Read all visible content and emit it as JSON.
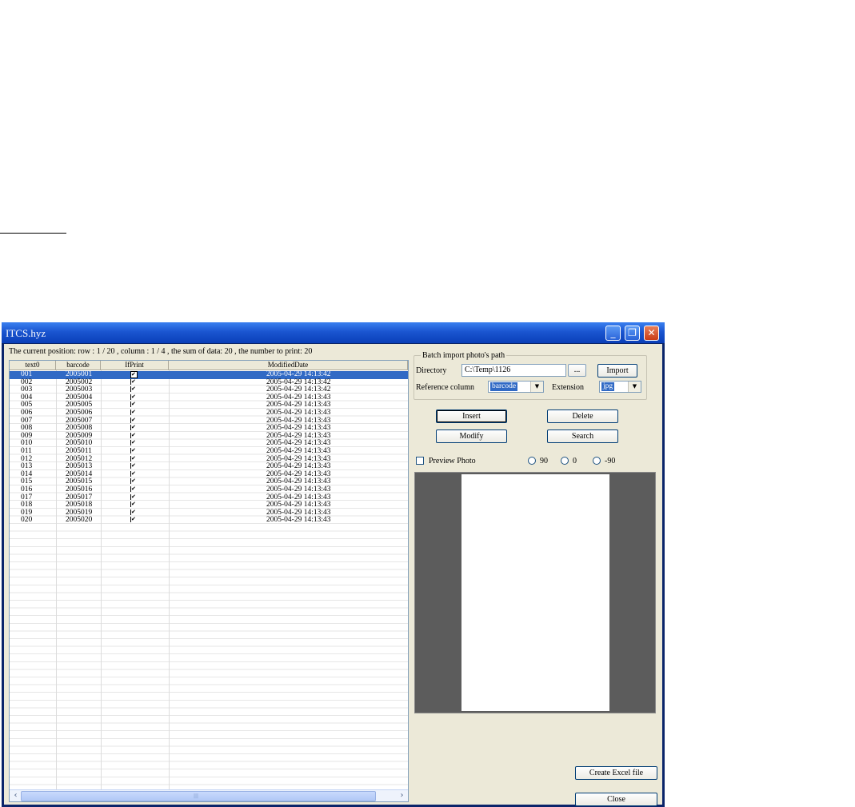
{
  "window": {
    "title": "ITCS.hyz"
  },
  "status": "The current position: row : 1 / 20 , column : 1 / 4 ,   the sum of data: 20 ,  the number to print: 20",
  "grid": {
    "columns": [
      "text0",
      "barcode",
      "IfPrint",
      "ModifiedDate"
    ],
    "rows": [
      {
        "text0": "001",
        "barcode": "2005001",
        "ifprint": "✔",
        "date": "2005-04-29 14:13:42"
      },
      {
        "text0": "002",
        "barcode": "2005002",
        "ifprint": "✔",
        "date": "2005-04-29 14:13:42"
      },
      {
        "text0": "003",
        "barcode": "2005003",
        "ifprint": "✔",
        "date": "2005-04-29 14:13:42"
      },
      {
        "text0": "004",
        "barcode": "2005004",
        "ifprint": "✔",
        "date": "2005-04-29 14:13:43"
      },
      {
        "text0": "005",
        "barcode": "2005005",
        "ifprint": "✔",
        "date": "2005-04-29 14:13:43"
      },
      {
        "text0": "006",
        "barcode": "2005006",
        "ifprint": "✔",
        "date": "2005-04-29 14:13:43"
      },
      {
        "text0": "007",
        "barcode": "2005007",
        "ifprint": "✔",
        "date": "2005-04-29 14:13:43"
      },
      {
        "text0": "008",
        "barcode": "2005008",
        "ifprint": "✔",
        "date": "2005-04-29 14:13:43"
      },
      {
        "text0": "009",
        "barcode": "2005009",
        "ifprint": "✔",
        "date": "2005-04-29 14:13:43"
      },
      {
        "text0": "010",
        "barcode": "2005010",
        "ifprint": "✔",
        "date": "2005-04-29 14:13:43"
      },
      {
        "text0": "011",
        "barcode": "2005011",
        "ifprint": "✔",
        "date": "2005-04-29 14:13:43"
      },
      {
        "text0": "012",
        "barcode": "2005012",
        "ifprint": "✔",
        "date": "2005-04-29 14:13:43"
      },
      {
        "text0": "013",
        "barcode": "2005013",
        "ifprint": "✔",
        "date": "2005-04-29 14:13:43"
      },
      {
        "text0": "014",
        "barcode": "2005014",
        "ifprint": "✔",
        "date": "2005-04-29 14:13:43"
      },
      {
        "text0": "015",
        "barcode": "2005015",
        "ifprint": "✔",
        "date": "2005-04-29 14:13:43"
      },
      {
        "text0": "016",
        "barcode": "2005016",
        "ifprint": "✔",
        "date": "2005-04-29 14:13:43"
      },
      {
        "text0": "017",
        "barcode": "2005017",
        "ifprint": "✔",
        "date": "2005-04-29 14:13:43"
      },
      {
        "text0": "018",
        "barcode": "2005018",
        "ifprint": "✔",
        "date": "2005-04-29 14:13:43"
      },
      {
        "text0": "019",
        "barcode": "2005019",
        "ifprint": "✔",
        "date": "2005-04-29 14:13:43"
      },
      {
        "text0": "020",
        "barcode": "2005020",
        "ifprint": "✔",
        "date": "2005-04-29 14:13:43"
      }
    ],
    "selected_row_index": 0,
    "scroll_left_icon": "scroll-left-icon",
    "scroll_right_icon": "scroll-right-icon",
    "scroll_grip": "|||"
  },
  "batch": {
    "legend": "Batch import photo's path",
    "directory_label": "Directory",
    "directory_value": "C:\\Temp\\1126",
    "browse_label": "...",
    "import_label": "Import",
    "reference_label": "Reference column",
    "reference_value": "barcode",
    "extension_label": "Extension",
    "extension_value": "jpg"
  },
  "actions": {
    "insert": "Insert",
    "delete": "Delete",
    "modify": "Modify",
    "search": "Search"
  },
  "preview": {
    "checkbox_label": "Preview Photo",
    "preview_checked": false,
    "rotations": [
      "90",
      "0",
      "-90"
    ],
    "selected_rotation": null
  },
  "footer": {
    "excel": "Create Excel file",
    "close": "Close"
  },
  "colors": {
    "title_bar": "#1a55d0",
    "selection": "#316ac5",
    "face": "#ece9d8",
    "preview_bg": "#5c5c5c"
  }
}
